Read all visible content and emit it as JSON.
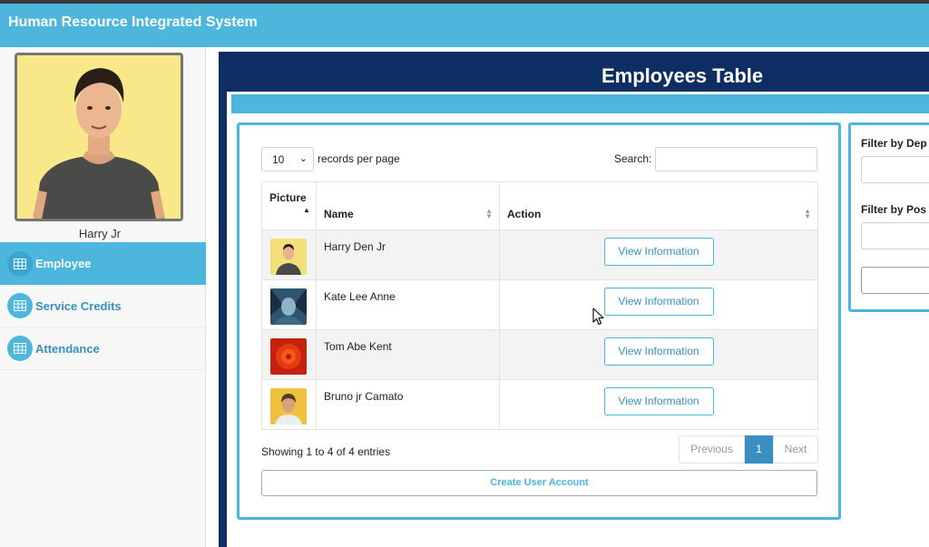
{
  "app": {
    "title": "Human Resource Integrated System"
  },
  "sidebar": {
    "user_name": "Harry Jr",
    "items": [
      {
        "label": "Employee",
        "icon": "table-icon",
        "active": true
      },
      {
        "label": "Service Credits",
        "icon": "table-icon",
        "active": false
      },
      {
        "label": "Attendance",
        "icon": "table-icon",
        "active": false
      }
    ]
  },
  "main": {
    "title": "Employees Table"
  },
  "table_controls": {
    "page_length": "10",
    "records_label": "records per page",
    "search_label": "Search:",
    "search_value": ""
  },
  "table": {
    "columns": [
      "Picture",
      "Name",
      "Action"
    ],
    "rows": [
      {
        "name": "Harry Den Jr",
        "action": "View Information"
      },
      {
        "name": "Kate Lee Anne",
        "action": "View Information"
      },
      {
        "name": "Tom Abe Kent",
        "action": "View Information"
      },
      {
        "name": "Bruno jr Camato",
        "action": "View Information"
      }
    ]
  },
  "footer": {
    "info": "Showing 1 to 4 of 4 entries",
    "previous": "Previous",
    "page": "1",
    "next": "Next",
    "create_button": "Create User Account"
  },
  "filters": {
    "department_label": "Filter by Dep",
    "position_label": "Filter by Pos"
  },
  "colors": {
    "accent": "#4db6dd",
    "navy": "#0d2d63",
    "link": "#3a8fc0"
  }
}
